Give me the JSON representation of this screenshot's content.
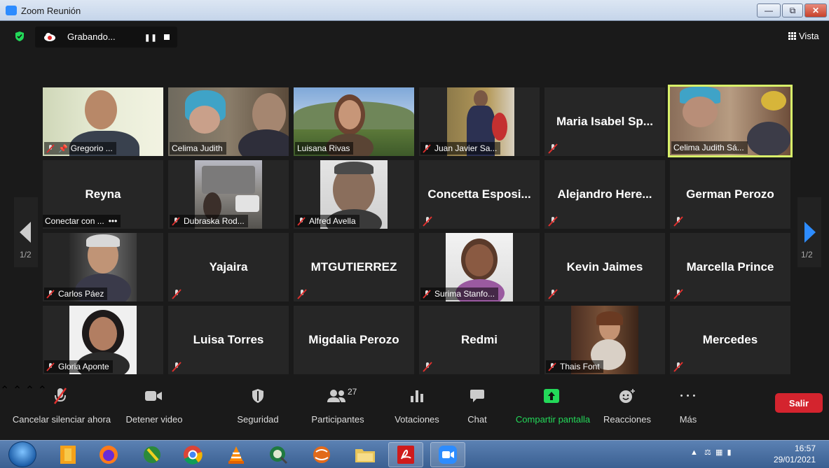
{
  "window": {
    "title": "Zoom Reunión"
  },
  "top": {
    "recording": "Grabando...",
    "view": "Vista"
  },
  "pagination": {
    "left": "1/2",
    "right": "1/2"
  },
  "tiles": [
    {
      "name": "Gregorio ...",
      "video": true
    },
    {
      "name": "Celima Judith",
      "video": true
    },
    {
      "name": "Luisana Rivas",
      "video": true
    },
    {
      "name": "Juan Javier Sa...",
      "video": true
    },
    {
      "name": "Maria Isabel Sp...",
      "video": false
    },
    {
      "name": "Celima Judith Sá...",
      "video": true,
      "active": true
    },
    {
      "name": "Reyna",
      "caption": "Conectar con ...",
      "video": false
    },
    {
      "name": "Dubraska Rod...",
      "video": true
    },
    {
      "name": "Alfred Avella",
      "video": true
    },
    {
      "name": "Concetta Esposi...",
      "video": false
    },
    {
      "name": "Alejandro Here...",
      "video": false
    },
    {
      "name": "German Perozo",
      "video": false
    },
    {
      "name": "Carlos Páez",
      "video": true
    },
    {
      "name": "Yajaira",
      "video": false
    },
    {
      "name": "MTGUTIERREZ",
      "video": false
    },
    {
      "name": "Surima Stanfo...",
      "video": true
    },
    {
      "name": "Kevin Jaimes",
      "video": false
    },
    {
      "name": "Marcella Prince",
      "video": false
    },
    {
      "name": "Gloria Aponte",
      "video": true
    },
    {
      "name": "Luisa Torres",
      "video": false
    },
    {
      "name": "Migdalia Perozo",
      "video": false
    },
    {
      "name": "Redmi",
      "video": false
    },
    {
      "name": "Thais Font",
      "video": true
    },
    {
      "name": "Mercedes",
      "video": false
    }
  ],
  "toolbar": {
    "unmute": "Cancelar silenciar ahora",
    "stop_video": "Detener video",
    "security": "Seguridad",
    "participants": "Participantes",
    "participants_count": "27",
    "polls": "Votaciones",
    "chat": "Chat",
    "share": "Compartir pantalla",
    "reactions": "Reacciones",
    "more": "Más",
    "more_dots": "• • •",
    "leave": "Salir"
  },
  "taskbar": {
    "time": "16:57",
    "date": "29/01/2021"
  },
  "colors": {
    "accent_green": "#23d959",
    "leave_red": "#d4242e",
    "active_border": "#d8f06a"
  }
}
